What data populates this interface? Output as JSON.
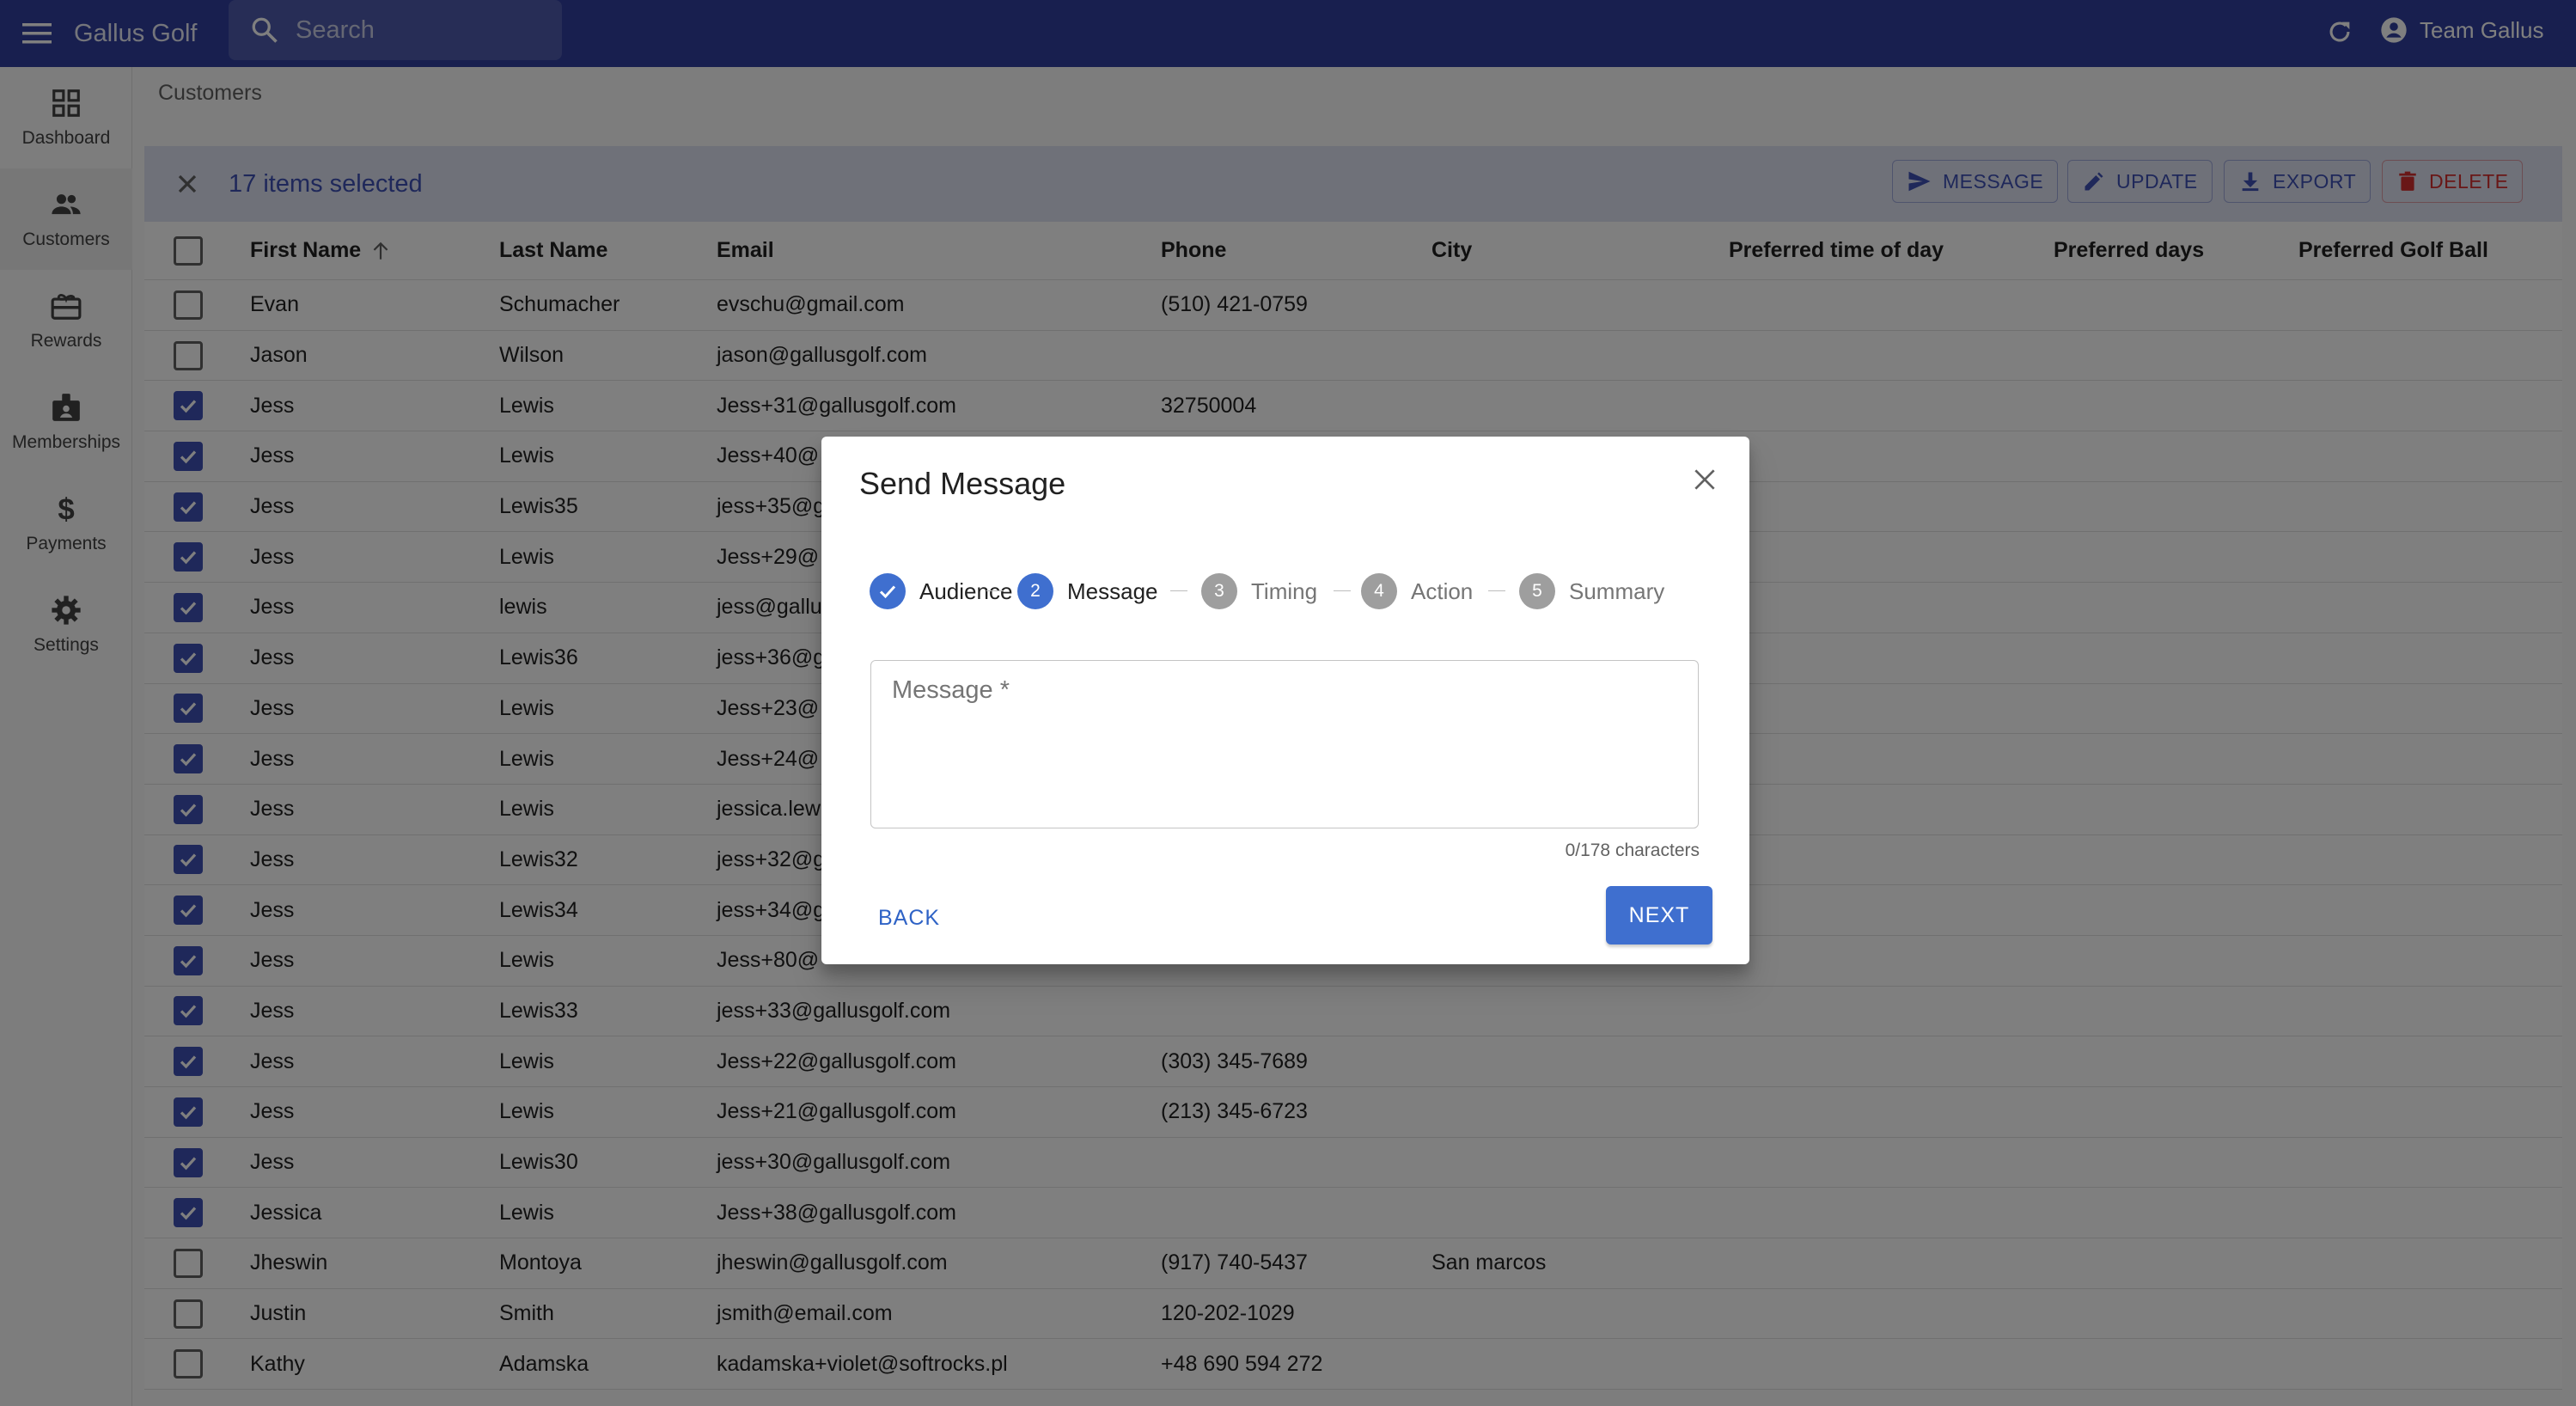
{
  "app": {
    "title": "Gallus Golf",
    "search_placeholder": "Search",
    "account_name": "Team Gallus"
  },
  "sidebar": {
    "items": [
      {
        "label": "Dashboard",
        "icon": "dashboard-icon"
      },
      {
        "label": "Customers",
        "icon": "people-icon"
      },
      {
        "label": "Rewards",
        "icon": "card-giftcard-icon"
      },
      {
        "label": "Memberships",
        "icon": "badge-icon"
      },
      {
        "label": "Payments",
        "icon": "dollar-icon"
      },
      {
        "label": "Settings",
        "icon": "gear-icon"
      }
    ],
    "active": "Customers"
  },
  "breadcrumb": "Customers",
  "bulk": {
    "selected_text": "17 items selected",
    "actions": {
      "message": "MESSAGE",
      "update": "UPDATE",
      "export": "EXPORT",
      "delete": "DELETE"
    }
  },
  "table": {
    "headers": {
      "first_name": "First Name",
      "last_name": "Last Name",
      "email": "Email",
      "phone": "Phone",
      "city": "City",
      "time": "Preferred time of day",
      "days": "Preferred days",
      "ball": "Preferred Golf Ball"
    },
    "rows": [
      {
        "checked": false,
        "first": "Evan",
        "last": "Schumacher",
        "email": "evschu@gmail.com",
        "phone": "(510) 421-0759",
        "city": ""
      },
      {
        "checked": false,
        "first": "Jason",
        "last": "Wilson",
        "email": "jason@gallusgolf.com",
        "phone": "",
        "city": ""
      },
      {
        "checked": true,
        "first": "Jess",
        "last": "Lewis",
        "email": "Jess+31@gallusgolf.com",
        "phone": "32750004",
        "city": ""
      },
      {
        "checked": true,
        "first": "Jess",
        "last": "Lewis",
        "email": "Jess+40@",
        "phone": "",
        "city": ""
      },
      {
        "checked": true,
        "first": "Jess",
        "last": "Lewis35",
        "email": "jess+35@g",
        "phone": "",
        "city": ""
      },
      {
        "checked": true,
        "first": "Jess",
        "last": "Lewis",
        "email": "Jess+29@",
        "phone": "",
        "city": ""
      },
      {
        "checked": true,
        "first": "Jess",
        "last": "lewis",
        "email": "jess@gallu",
        "phone": "",
        "city": ""
      },
      {
        "checked": true,
        "first": "Jess",
        "last": "Lewis36",
        "email": "jess+36@g",
        "phone": "",
        "city": ""
      },
      {
        "checked": true,
        "first": "Jess",
        "last": "Lewis",
        "email": "Jess+23@",
        "phone": "",
        "city": ""
      },
      {
        "checked": true,
        "first": "Jess",
        "last": "Lewis",
        "email": "Jess+24@",
        "phone": "",
        "city": ""
      },
      {
        "checked": true,
        "first": "Jess",
        "last": "Lewis",
        "email": "jessica.lew",
        "phone": "",
        "city": ""
      },
      {
        "checked": true,
        "first": "Jess",
        "last": "Lewis32",
        "email": "jess+32@g",
        "phone": "",
        "city": ""
      },
      {
        "checked": true,
        "first": "Jess",
        "last": "Lewis34",
        "email": "jess+34@g",
        "phone": "",
        "city": ""
      },
      {
        "checked": true,
        "first": "Jess",
        "last": "Lewis",
        "email": "Jess+80@",
        "phone": "",
        "city": ""
      },
      {
        "checked": true,
        "first": "Jess",
        "last": "Lewis33",
        "email": "jess+33@gallusgolf.com",
        "phone": "",
        "city": ""
      },
      {
        "checked": true,
        "first": "Jess",
        "last": "Lewis",
        "email": "Jess+22@gallusgolf.com",
        "phone": "(303) 345-7689",
        "city": ""
      },
      {
        "checked": true,
        "first": "Jess",
        "last": "Lewis",
        "email": "Jess+21@gallusgolf.com",
        "phone": "(213) 345-6723",
        "city": ""
      },
      {
        "checked": true,
        "first": "Jess",
        "last": "Lewis30",
        "email": "jess+30@gallusgolf.com",
        "phone": "",
        "city": ""
      },
      {
        "checked": true,
        "first": "Jessica",
        "last": "Lewis",
        "email": "Jess+38@gallusgolf.com",
        "phone": "",
        "city": ""
      },
      {
        "checked": false,
        "first": "Jheswin",
        "last": "Montoya",
        "email": "jheswin@gallusgolf.com",
        "phone": "(917) 740-5437",
        "city": "San marcos"
      },
      {
        "checked": false,
        "first": "Justin",
        "last": "Smith",
        "email": "jsmith@email.com",
        "phone": "120-202-1029",
        "city": ""
      },
      {
        "checked": false,
        "first": "Kathy",
        "last": "Adamska",
        "email": "kadamska+violet@softrocks.pl",
        "phone": "+48 690 594 272",
        "city": ""
      }
    ]
  },
  "dialog": {
    "title": "Send Message",
    "steps": [
      {
        "num": "1",
        "label": "Audience",
        "state": "done"
      },
      {
        "num": "2",
        "label": "Message",
        "state": "active"
      },
      {
        "num": "3",
        "label": "Timing",
        "state": "pending"
      },
      {
        "num": "4",
        "label": "Action",
        "state": "pending"
      },
      {
        "num": "5",
        "label": "Summary",
        "state": "pending"
      }
    ],
    "message_placeholder": "Message *",
    "message_value": "",
    "char_count": "0/178 characters",
    "back_label": "BACK",
    "next_label": "NEXT"
  },
  "colors": {
    "appbar": "#303f9f",
    "primary": "#3f51b5",
    "step_active": "#3f6fcf",
    "delete": "#d32f2f"
  }
}
